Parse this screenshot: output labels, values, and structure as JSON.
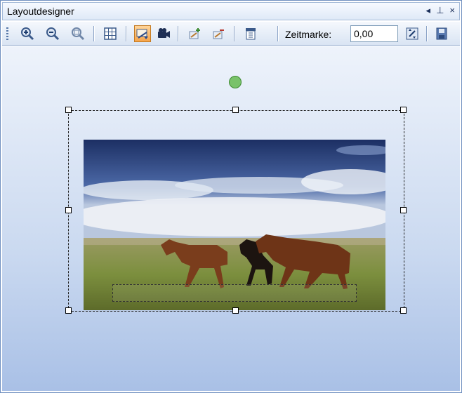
{
  "window": {
    "title": "Layoutdesigner"
  },
  "title_controls": {
    "pin_left": "◂",
    "pin": "⊥",
    "close": "×"
  },
  "toolbar": {
    "buttons": [
      {
        "name": "zoom-in-icon"
      },
      {
        "name": "zoom-out-icon"
      },
      {
        "name": "zoom-fit-icon"
      },
      {
        "name": "grid-icon"
      },
      {
        "name": "select-tool-icon",
        "active": true
      },
      {
        "name": "camera-icon"
      },
      {
        "name": "add-keyframe-icon"
      },
      {
        "name": "remove-keyframe-icon"
      },
      {
        "name": "properties-icon"
      }
    ],
    "zeitmarke_label": "Zeitmarke:",
    "zeitmarke_value": "0,00"
  },
  "colors": {
    "accent_active": "#f5a44a",
    "rotation_handle": "#79c26a"
  }
}
